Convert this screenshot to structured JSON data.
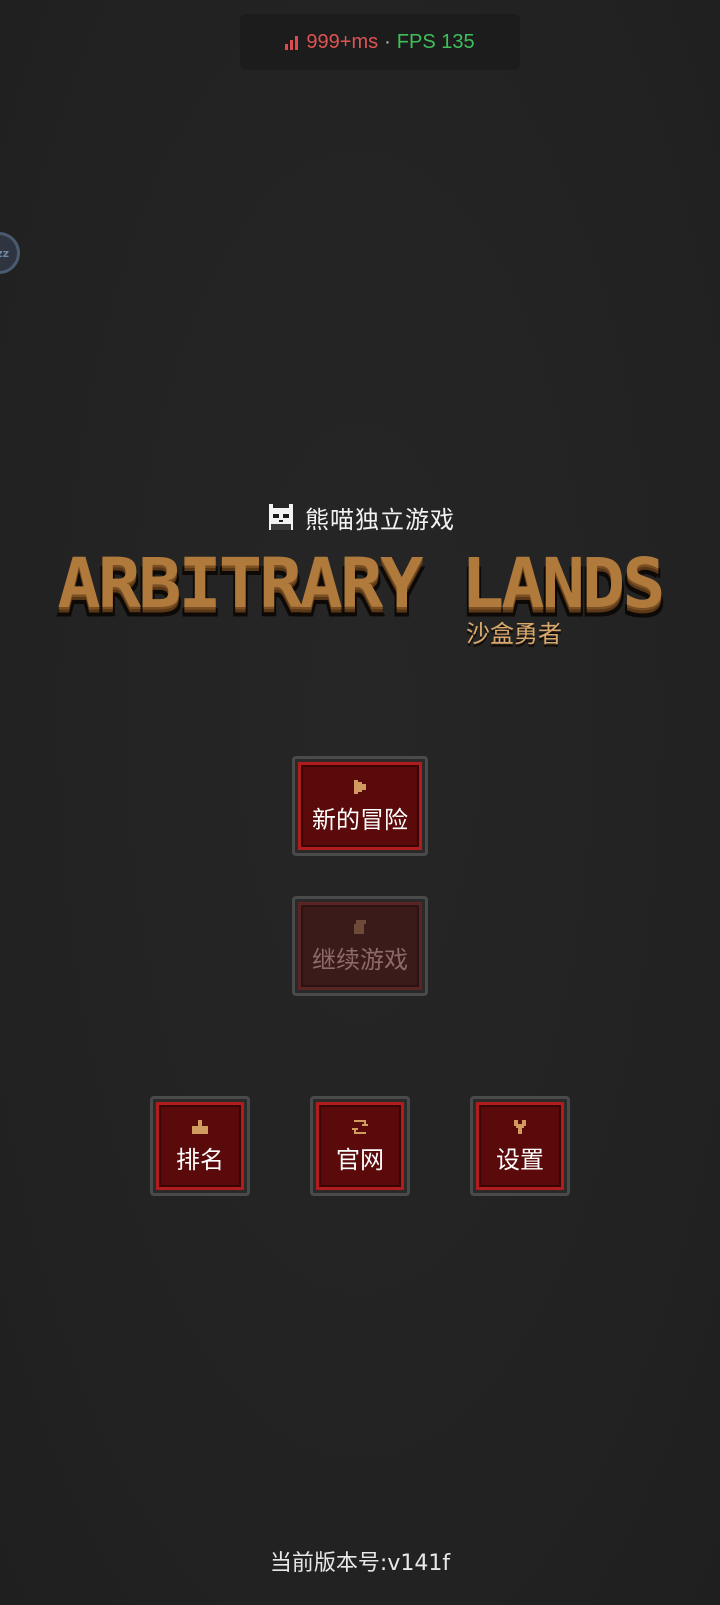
{
  "perf_overlay": {
    "latency": "999+ms",
    "separator": "·",
    "fps": "FPS 135",
    "latency_color": "#e05353",
    "fps_color": "#3fbf5a"
  },
  "floating_bubble": {
    "text": "zz"
  },
  "logo": {
    "studio_name": "熊喵独立游戏",
    "studio_icon": "panda-icon",
    "title": "ARBITRARY LANDS",
    "subtitle": "沙盒勇者",
    "title_color": "#b07a3c"
  },
  "menu": {
    "new_adventure": {
      "label": "新的冒险",
      "icon": "play-icon"
    },
    "continue_game": {
      "label": "继续游戏",
      "icon": "scroll-icon",
      "disabled": true
    },
    "ranking": {
      "label": "排名",
      "icon": "podium-icon"
    },
    "website": {
      "label": "官网",
      "icon": "refresh-icon"
    },
    "settings": {
      "label": "设置",
      "icon": "wrench-icon"
    }
  },
  "footer": {
    "version": "当前版本号:v141f"
  }
}
